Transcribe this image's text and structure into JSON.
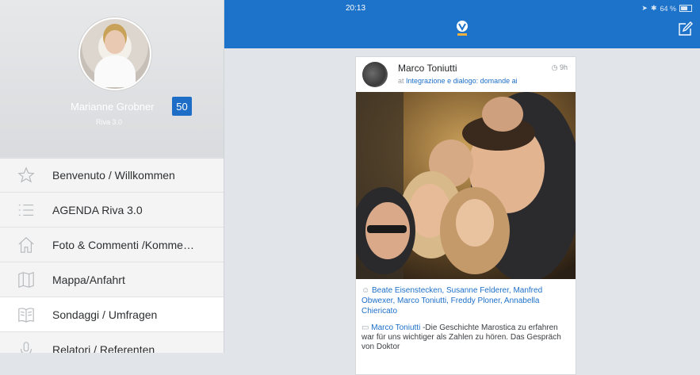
{
  "sidebar": {
    "profile": {
      "name": "Marianne Grobner",
      "subtitle": "Riva 3.0",
      "badge_count": "50"
    },
    "menu": [
      {
        "label": "Benvenuto / Willkommen",
        "icon": "star-icon",
        "active": false
      },
      {
        "label": "AGENDA Riva 3.0",
        "icon": "list-icon",
        "active": false
      },
      {
        "label": "Foto & Commenti /Komme…",
        "icon": "home-icon",
        "active": false
      },
      {
        "label": "Mappa/Anfahrt",
        "icon": "map-icon",
        "active": false
      },
      {
        "label": "Sondaggi / Umfragen",
        "icon": "book-icon",
        "active": true
      },
      {
        "label": "Relatori / Referenten",
        "icon": "microphone-icon",
        "active": false
      }
    ]
  },
  "status": {
    "time": "20:13",
    "battery": "64 %"
  },
  "colors": {
    "brand_blue": "#1d72c9",
    "badge_blue": "#1e6ec8",
    "link_blue": "#1d6fc8"
  },
  "post": {
    "author": "Marco Toniutti",
    "group_prefix": "at",
    "group": "Integrazione e dialogo: domande ai",
    "time": "9h",
    "likes": "Beate Eisenstecken, Susanne Felderer, Manfred Obwexer, Marco Toniutti, Freddy Ploner, Annabella Chiericato",
    "comment_author": "Marco Toniutti",
    "comment_text": " -Die Geschichte Marostica zu erfahren war für uns wichtiger als Zahlen zu hören. Das Gespräch von Doktor"
  }
}
